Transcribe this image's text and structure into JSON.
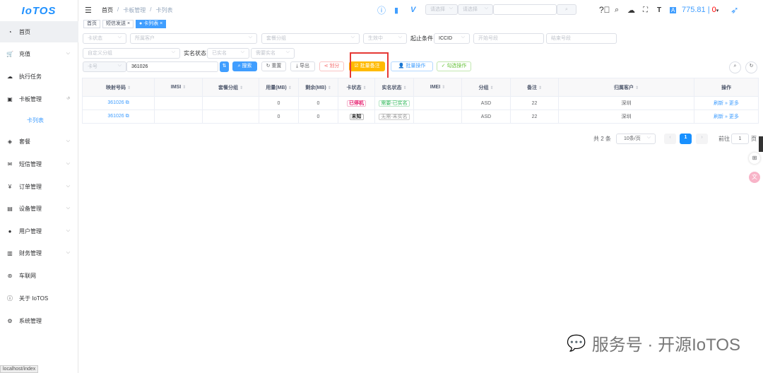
{
  "logo": "IoTOS",
  "sidebar": [
    {
      "label": "首页",
      "icon": "dashboard-icon"
    },
    {
      "label": "充值",
      "icon": "cart-icon"
    },
    {
      "label": "执行任务",
      "icon": "task-icon"
    },
    {
      "label": "卡板管理",
      "icon": "card-icon"
    },
    {
      "label": "卡列表",
      "icon": ""
    },
    {
      "label": "套餐",
      "icon": "package-icon"
    },
    {
      "label": "短信管理",
      "icon": "mail-icon"
    },
    {
      "label": "订单管理",
      "icon": "yen-icon"
    },
    {
      "label": "设备管理",
      "icon": "device-icon"
    },
    {
      "label": "用户管理",
      "icon": "user-icon"
    },
    {
      "label": "财务管理",
      "icon": "finance-icon"
    },
    {
      "label": "车联网",
      "icon": "car-icon"
    },
    {
      "label": "关于 IoTOS",
      "icon": "info-icon"
    },
    {
      "label": "系统管理",
      "icon": "gear-icon"
    }
  ],
  "status_url": "localhost/index",
  "breadcrumb": [
    "首页",
    "卡板管理",
    "卡列表"
  ],
  "tags": [
    "首页",
    "短信发送",
    "卡列表"
  ],
  "header": {
    "sel1": "请选择",
    "sel2": "请选择",
    "balance": "775.81",
    "sep": "|",
    "count": "0"
  },
  "filters": {
    "card_status": "卡状态",
    "customer": "所属客户",
    "package_group": "套餐分组",
    "effective": "生效中",
    "range_label": "起止条件",
    "range_type": "ICCID",
    "start": "开始号段",
    "end": "结束号段",
    "custom_group": "自定义分组",
    "realname_label": "实名状态",
    "realname": "已实名",
    "need_realname": "需要实名",
    "key": "卡号",
    "value": "361026"
  },
  "buttons": {
    "search": "搜索",
    "reset": "重置",
    "export": "导出",
    "divide": "划分",
    "batch_note": "批量备注",
    "batch_op": "批量操作",
    "check_op": "勾选操作"
  },
  "table": {
    "headers": [
      "映射号码",
      "IMSI",
      "套餐分组",
      "用量(MB)",
      "剩余(MB)",
      "卡状态",
      "实名状态",
      "IMEI",
      "分组",
      "备注",
      "归属客户",
      "操作"
    ],
    "rows": [
      {
        "no": "361026",
        "imsi": "",
        "pkg": "",
        "used": "0",
        "left": "0",
        "status": "已停机",
        "realname": "需要-已实名",
        "imei": "",
        "group": "ASD",
        "note": "22",
        "customer": "深圳",
        "a1": "刷新",
        "a2": "更多"
      },
      {
        "no": "361026",
        "imsi": "",
        "pkg": "",
        "used": "0",
        "left": "0",
        "status": "未知",
        "realname": "无需-未实名",
        "imei": "",
        "group": "ASD",
        "note": "22",
        "customer": "深圳",
        "a1": "刷新",
        "a2": "更多"
      }
    ]
  },
  "pagination": {
    "total": "共 2 条",
    "size": "10条/页",
    "page": "1",
    "goto": "前往",
    "goto_val": "1",
    "unit": "页"
  },
  "watermark": "服务号 · 开源IoTOS"
}
